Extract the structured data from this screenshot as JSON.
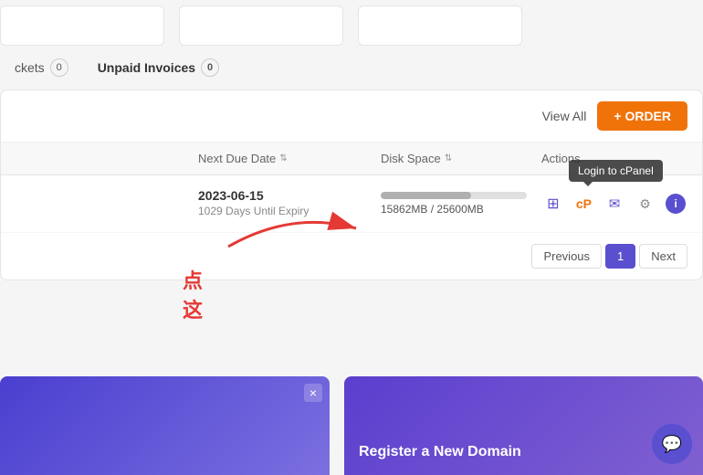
{
  "top": {
    "cards": [
      {},
      {},
      {}
    ]
  },
  "tabs": [
    {
      "label": "ckets",
      "badge": "0",
      "active": false
    },
    {
      "label": "Unpaid Invoices",
      "badge": "0",
      "active": true
    }
  ],
  "panel": {
    "view_all_label": "View All",
    "order_label": "+ ORDER",
    "table": {
      "columns": [
        {
          "label": ""
        },
        {
          "label": "Next Due Date",
          "sortable": true
        },
        {
          "label": "Disk Space",
          "sortable": true
        },
        {
          "label": "Actions"
        }
      ],
      "rows": [
        {
          "date": "2023-06-15",
          "expiry": "1029 Days Until Expiry",
          "disk_used": "15862MB",
          "disk_total": "25600MB",
          "disk_pct": 62
        }
      ]
    },
    "pagination": {
      "prev_label": "Previous",
      "current": "1",
      "next_label": "Next"
    },
    "tooltip": "Login to cPanel"
  },
  "annotation": {
    "text": "点这"
  },
  "bottom": {
    "promo_right_title": "Register a New Domain"
  },
  "icons": {
    "close": "×",
    "chat": "💬",
    "grid": "⊞",
    "cpanel": "cP",
    "mail": "✉",
    "gear": "⚙",
    "info": "i",
    "sort": "⇅",
    "plus": "+"
  }
}
